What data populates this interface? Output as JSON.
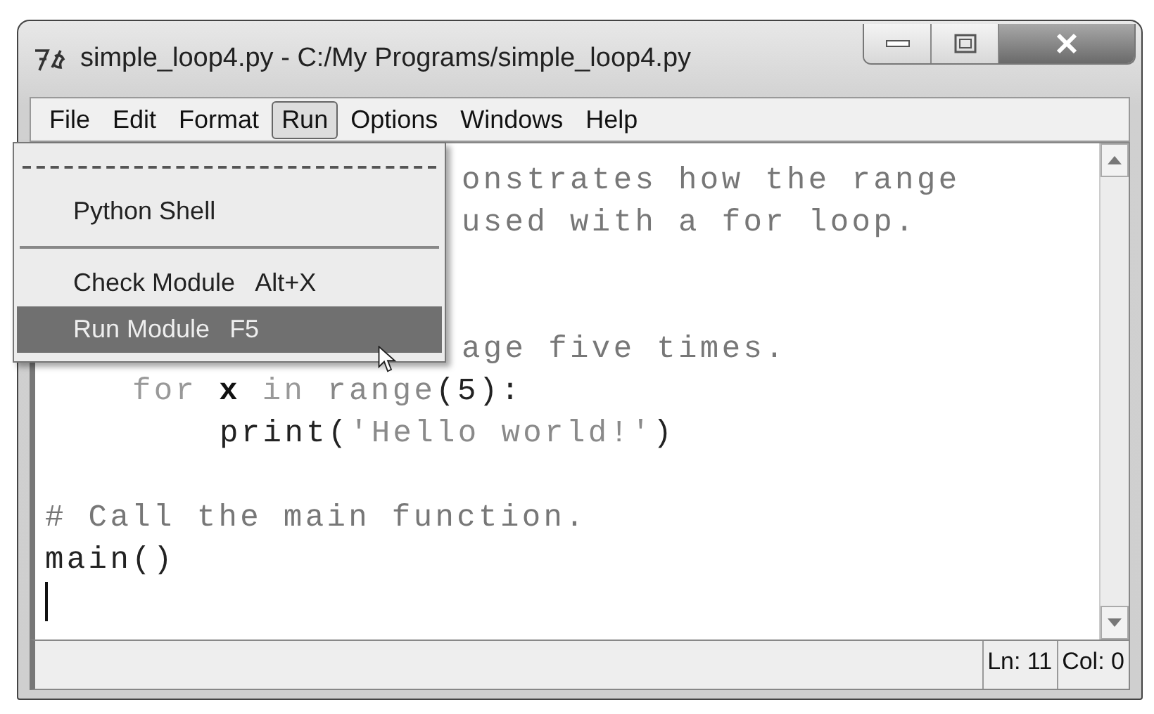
{
  "window": {
    "title": "simple_loop4.py - C:/My Programs/simple_loop4.py"
  },
  "menu_bar": [
    {
      "label": "File",
      "selected": false
    },
    {
      "label": "Edit",
      "selected": false
    },
    {
      "label": "Format",
      "selected": false
    },
    {
      "label": "Run",
      "selected": true
    },
    {
      "label": "Options",
      "selected": false
    },
    {
      "label": "Windows",
      "selected": false
    },
    {
      "label": "Help",
      "selected": false
    }
  ],
  "run_menu": [
    {
      "kind": "tearoff"
    },
    {
      "kind": "item",
      "label": "Python Shell",
      "selected": false
    },
    {
      "kind": "separator"
    },
    {
      "kind": "item",
      "label": "Check Module",
      "shortcut": "Alt+X",
      "selected": false
    },
    {
      "kind": "item",
      "label": "Run Module",
      "shortcut": "F5",
      "selected": true
    }
  ],
  "code_lines": [
    {
      "kind": "covered",
      "tokens": [
        {
          "kind": "comment",
          "text": "onstrates how the range"
        }
      ]
    },
    {
      "kind": "covered",
      "tokens": [
        {
          "kind": "comment",
          "text": "used with a for loop."
        }
      ]
    },
    {
      "kind": "covered"
    },
    {
      "kind": "covered"
    },
    {
      "kind": "covered",
      "tokens": [
        {
          "kind": "comment",
          "text": "age five times."
        }
      ]
    },
    {
      "kind": "block",
      "tokens": [
        {
          "kind": "keyword",
          "text": "for"
        },
        {
          "kind": "name",
          "text": "x"
        },
        {
          "kind": "keyword",
          "text": "in"
        },
        {
          "kind": "builtin",
          "text": "range"
        },
        {
          "kind": "code",
          "text": "(5):"
        }
      ]
    },
    {
      "kind": "nested",
      "tokens": [
        {
          "kind": "code",
          "text": "print("
        },
        {
          "kind": "string",
          "text": "'Hello world!'"
        },
        {
          "kind": "code",
          "text": ")"
        }
      ]
    },
    {
      "kind": "plain"
    },
    {
      "kind": "plain",
      "tokens": [
        {
          "kind": "comment",
          "text": "# Call the main function."
        }
      ]
    },
    {
      "kind": "plain",
      "tokens": [
        {
          "kind": "code",
          "text": "main()"
        }
      ]
    },
    {
      "kind": "cursor"
    }
  ],
  "status_bar": [
    "Ln: 11",
    "Col: 0"
  ]
}
